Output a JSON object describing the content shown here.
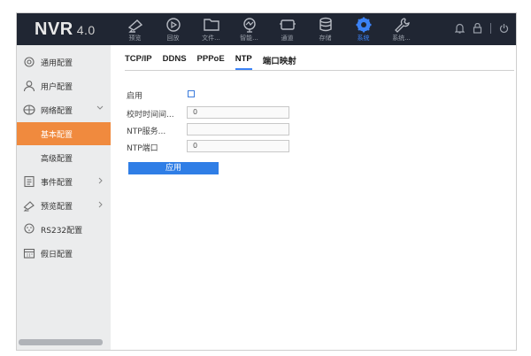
{
  "header": {
    "logo": "NVR",
    "version": "4.0",
    "nav": [
      {
        "label": "预览",
        "icon": "camera-icon"
      },
      {
        "label": "回放",
        "icon": "playback-icon"
      },
      {
        "label": "文件...",
        "icon": "folder-icon"
      },
      {
        "label": "智能...",
        "icon": "smart-icon"
      },
      {
        "label": "通道",
        "icon": "channel-icon"
      },
      {
        "label": "存储",
        "icon": "storage-icon"
      },
      {
        "label": "系统",
        "icon": "gear-icon"
      },
      {
        "label": "系统...",
        "icon": "wrench-icon"
      }
    ],
    "active_nav": "系统",
    "accent": "#3b82f6"
  },
  "sidebar": {
    "items": [
      {
        "label": "通用配置",
        "icon": "settings-circle-icon"
      },
      {
        "label": "用户配置",
        "icon": "user-icon"
      },
      {
        "label": "网络配置",
        "icon": "globe-icon"
      },
      {
        "label": "基本配置"
      },
      {
        "label": "高级配置"
      },
      {
        "label": "事件配置",
        "icon": "event-icon"
      },
      {
        "label": "预览配置",
        "icon": "camera-icon"
      },
      {
        "label": "RS232配置",
        "icon": "port-icon"
      },
      {
        "label": "假日配置",
        "icon": "calendar-icon"
      }
    ],
    "active_item": "基本配置",
    "active_color": "#f08a3e"
  },
  "tabs": [
    "TCP/IP",
    "DDNS",
    "PPPoE",
    "NTP",
    "端口映射"
  ],
  "active_tab": "NTP",
  "form": {
    "enable_label": "启用",
    "enable_checked": false,
    "interval_label": "校时时间间...",
    "interval_value": "0",
    "server_label": "NTP服务...",
    "server_value": "",
    "port_label": "NTP端口",
    "port_value": "0",
    "apply_label": "应用"
  }
}
